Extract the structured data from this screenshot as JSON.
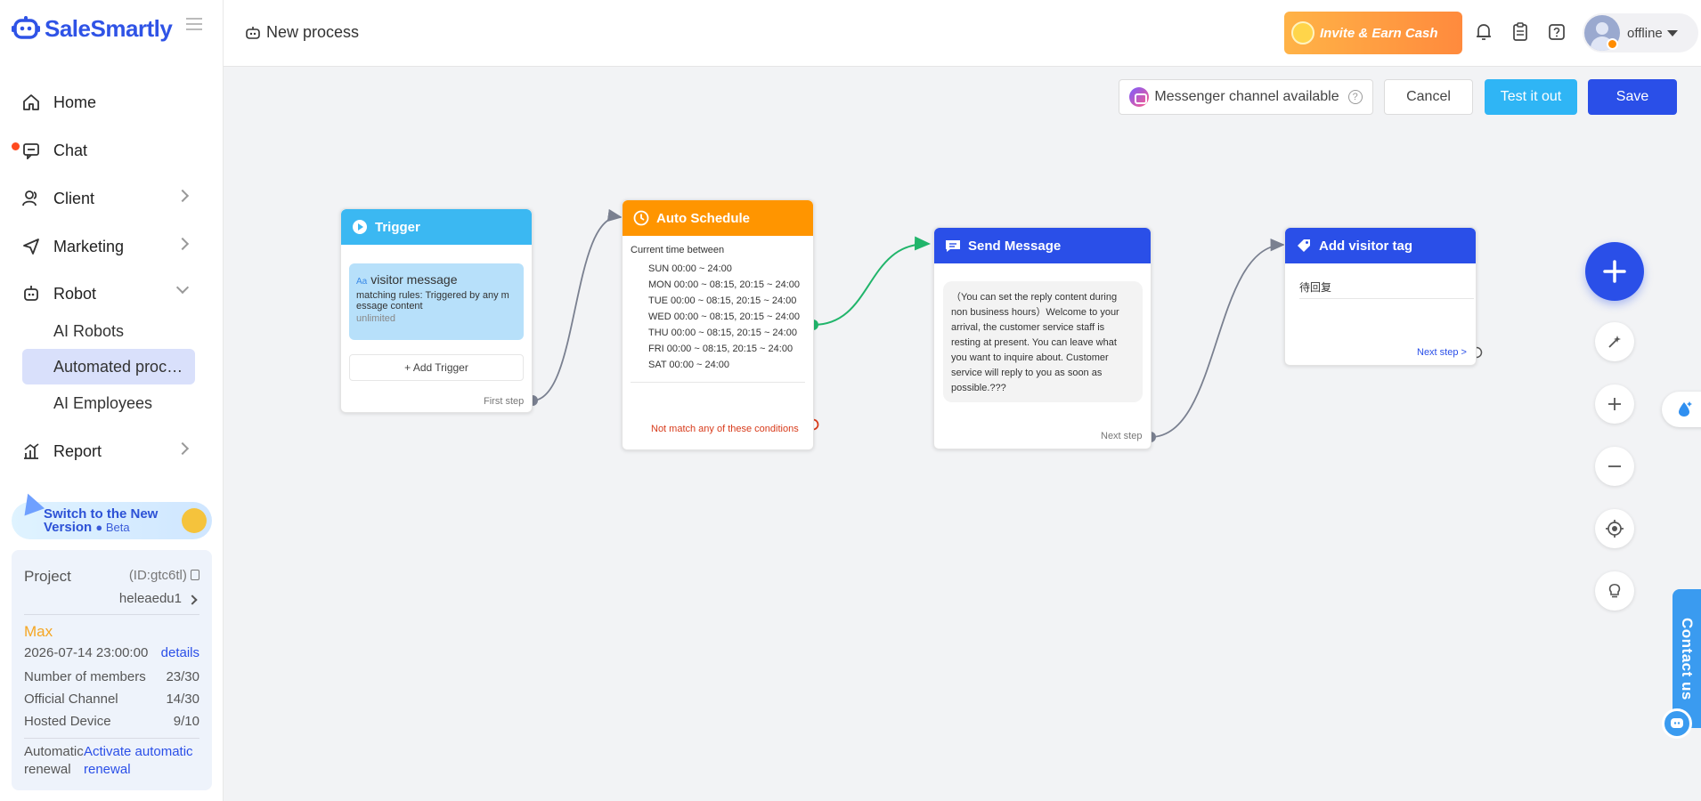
{
  "brand": {
    "name": "SaleSmartly",
    "color": "#2f53e6"
  },
  "sidebar": {
    "items": [
      {
        "label": "Home",
        "icon": "home-icon"
      },
      {
        "label": "Chat",
        "icon": "chat-icon",
        "unread_dot": true
      },
      {
        "label": "Client",
        "icon": "client-icon"
      },
      {
        "label": "Marketing",
        "icon": "send-icon"
      },
      {
        "label": "Robot",
        "icon": "robot-icon"
      },
      {
        "label": "Report",
        "icon": "report-icon"
      }
    ],
    "robot_sub": [
      "AI Robots",
      "Automated proc…",
      "AI Employees"
    ],
    "switch_banner": {
      "line1": "Switch to the New",
      "line2": "Version",
      "beta": "● Beta"
    },
    "project": {
      "label": "Project",
      "id": "(ID:gtc6tl)",
      "name": "heleaedu1",
      "plan": "Max",
      "expiry": "2026-07-14 23:00:00",
      "details_link": "details",
      "stats": [
        {
          "label": "Number of members",
          "value": "23/30"
        },
        {
          "label": "Official Channel",
          "value": "14/30"
        },
        {
          "label": "Hosted Device",
          "value": "9/10"
        }
      ],
      "renewal_label_1": "Automatic",
      "renewal_label_2": "renewal",
      "renewal_link_1": "Activate automatic",
      "renewal_link_2": "renewal"
    }
  },
  "header": {
    "title": "New process",
    "invite": "Invite & Earn Cash",
    "status": "offline",
    "icons": [
      "bell-icon",
      "clipboard-icon",
      "help-icon"
    ]
  },
  "actions": {
    "channel": "Messenger channel available",
    "cancel": "Cancel",
    "test": "Test it out",
    "save": "Save"
  },
  "colors": {
    "trigger": "#3bb8f2",
    "schedule": "#ff9500",
    "send": "#2a4fe8",
    "tag": "#2a4fe8",
    "success_link": "#21b56b",
    "nomatch": "#d83b1b"
  },
  "nodes": {
    "trigger": {
      "title": "Trigger",
      "card_icon": "Aa",
      "card_title": "visitor message",
      "rule_line1": "matching rules: Triggered by any m",
      "rule_line2": "essage content",
      "limit": "unlimited",
      "add": "+ Add Trigger",
      "port": "First step"
    },
    "schedule": {
      "title": "Auto Schedule",
      "caption": "Current time between",
      "rows": [
        "SUN 00:00 ~ 24:00",
        "MON 00:00 ~ 08:15, 20:15 ~ 24:00",
        "TUE 00:00 ~ 08:15, 20:15 ~ 24:00",
        "WED 00:00 ~ 08:15, 20:15 ~ 24:00",
        "THU 00:00 ~ 08:15, 20:15 ~ 24:00",
        "FRI 00:00 ~ 08:15, 20:15 ~ 24:00",
        "SAT 00:00 ~ 24:00"
      ],
      "nomatch": "Not match any of these conditions"
    },
    "send": {
      "title": "Send Message",
      "text": "（You can set the reply content during non business hours）Welcome to your arrival, the customer service staff is resting at present. You can leave what you want to inquire about. Customer service will reply to you as soon as possible.???",
      "port": "Next step"
    },
    "tag": {
      "title": "Add visitor tag",
      "value": "待回复",
      "port": "Next step >"
    }
  },
  "tools": [
    "add-node-icon",
    "magic-wand-icon",
    "zoom-in-icon",
    "zoom-out-icon",
    "locate-icon",
    "bulb-icon"
  ],
  "contact": "Contact us"
}
